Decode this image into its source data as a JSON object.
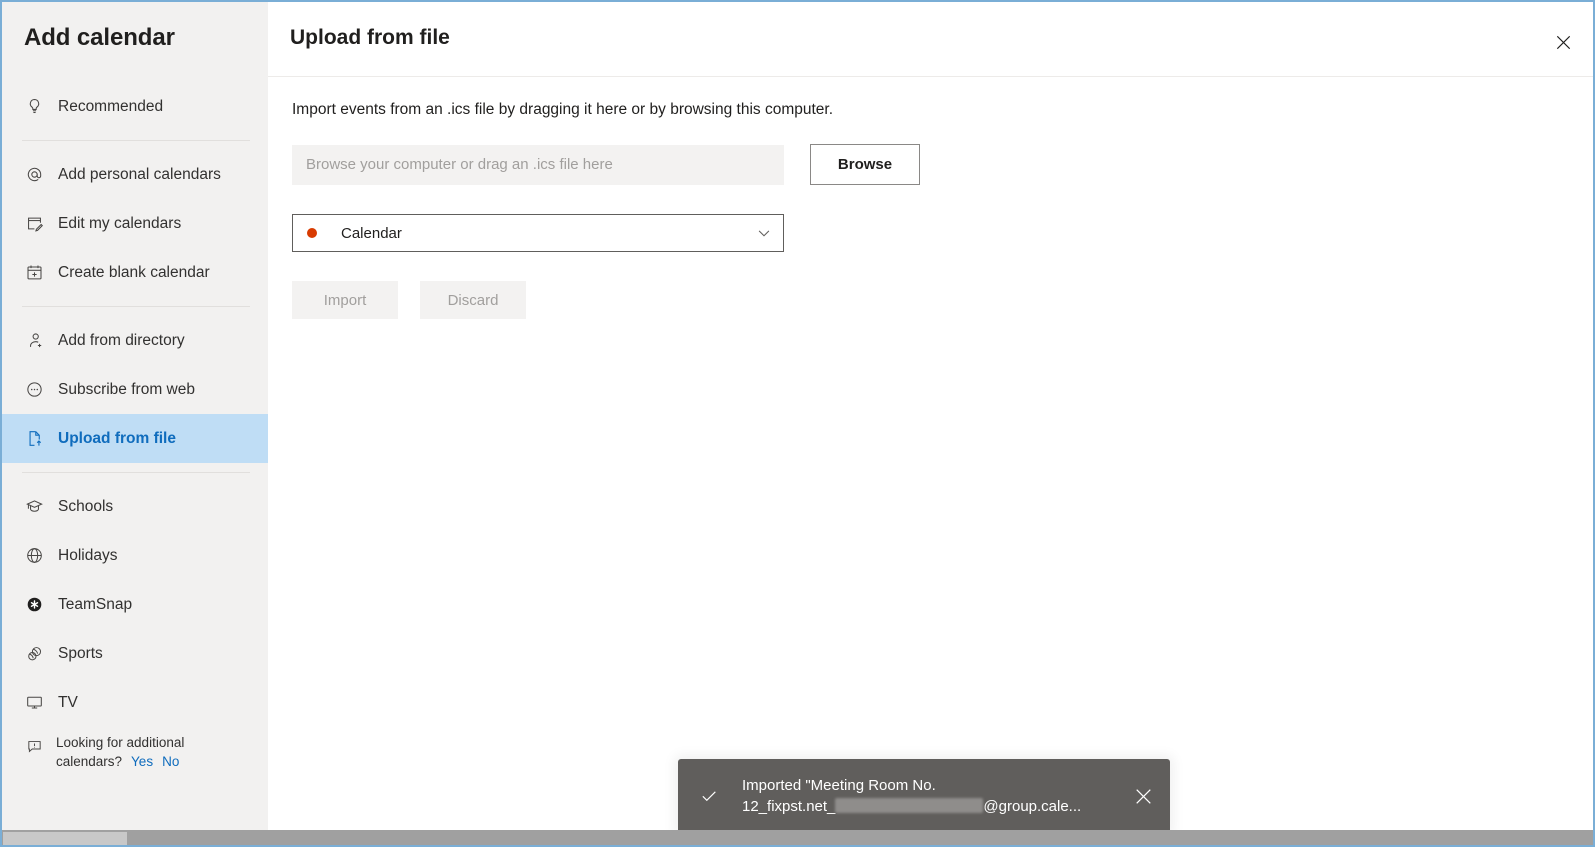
{
  "window": {
    "border_color": "#7aaed6"
  },
  "sidebar": {
    "title": "Add calendar",
    "groups": [
      {
        "items": [
          {
            "label": "Recommended",
            "icon": "lightbulb-icon",
            "selected": false
          }
        ]
      },
      {
        "items": [
          {
            "label": "Add personal calendars",
            "icon": "at-sign-icon",
            "selected": false
          },
          {
            "label": "Edit my calendars",
            "icon": "edit-page-icon",
            "selected": false
          },
          {
            "label": "Create blank calendar",
            "icon": "calendar-plus-icon",
            "selected": false
          }
        ]
      },
      {
        "items": [
          {
            "label": "Add from directory",
            "icon": "person-add-icon",
            "selected": false
          },
          {
            "label": "Subscribe from web",
            "icon": "subscribe-circle-icon",
            "selected": false
          },
          {
            "label": "Upload from file",
            "icon": "file-upload-icon",
            "selected": true
          }
        ]
      },
      {
        "items": [
          {
            "label": "Schools",
            "icon": "graduation-cap-icon",
            "selected": false
          },
          {
            "label": "Holidays",
            "icon": "globe-icon",
            "selected": false
          },
          {
            "label": "TeamSnap",
            "icon": "teamsnap-asterisk-icon",
            "selected": false
          },
          {
            "label": "Sports",
            "icon": "sports-balls-icon",
            "selected": false
          },
          {
            "label": "TV",
            "icon": "monitor-icon",
            "selected": false
          }
        ]
      }
    ],
    "selected_color": "#0f6cbd",
    "selected_bg": "#bfddf5",
    "feedback": {
      "icon": "feedback-comment-icon",
      "question": "Looking for additional calendars?",
      "yes_label": "Yes",
      "no_label": "No"
    }
  },
  "main": {
    "title": "Upload from file",
    "close_icon": "close-icon",
    "description": "Import events from an .ics file by dragging it here or by browsing this computer.",
    "file_input": {
      "value": "",
      "placeholder": "Browse your computer or drag an .ics file here"
    },
    "browse_label": "Browse",
    "calendar_select": {
      "value": "Calendar",
      "dot_color": "#d83b01",
      "chevron_icon": "chevron-down-icon"
    },
    "import_label": "Import",
    "discard_label": "Discard"
  },
  "toast": {
    "status_icon": "checkmark-icon",
    "line1": "Imported \"Meeting Room No.",
    "line2_prefix": "12_fixpst.net_",
    "line2_suffix": "@group.cale...",
    "close_icon": "close-icon",
    "background": "#605e5c"
  }
}
